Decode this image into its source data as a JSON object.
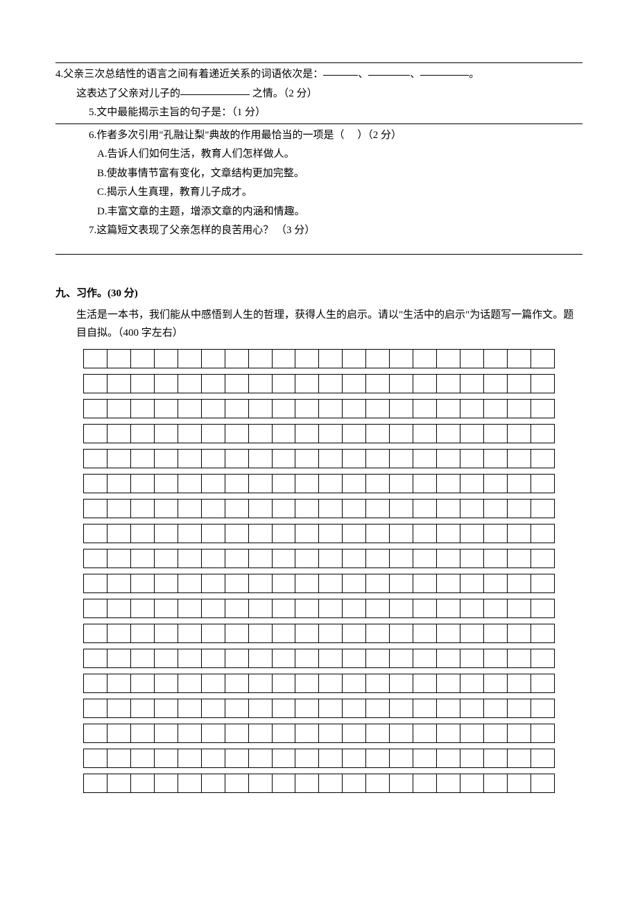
{
  "line3": "",
  "q4": {
    "prefix": "4.父亲三次总结性的语言之间有着递近关系的词语依次是：",
    "sep1": "、",
    "sep2": "、",
    "suffix": "。",
    "line2_a": "这表达了父亲对儿子的",
    "line2_b": " 之情。（2 分）"
  },
  "q5": {
    "text": "5.文中最能揭示主旨的句子是：（1 分）"
  },
  "q6": {
    "stem_a": "6.作者多次引用\"孔融让梨\"典故的作用最恰当的一项是（",
    "stem_b": "）（2 分）",
    "optA": "A.告诉人们如何生活，教育人们怎样做人。",
    "optB": "B.使故事情节富有变化，文章结构更加完整。",
    "optC": "C.揭示人生真理，教育儿子成才。",
    "optD": "D.丰富文章的主题，增添文章的内涵和情趣。"
  },
  "q7": {
    "text": "7.这篇短文表现了父亲怎样的良苦用心？ （3 分）"
  },
  "section9": {
    "header": "九、习作。(30 分)",
    "prompt": "生活是一本书，我们能从中感悟到人生的哲理，获得人生的启示。请以\"生活中的启示\"为话题写一篇作文。题目自拟。（400 字左右）"
  },
  "grid": {
    "rows": 18,
    "cols": 20
  }
}
